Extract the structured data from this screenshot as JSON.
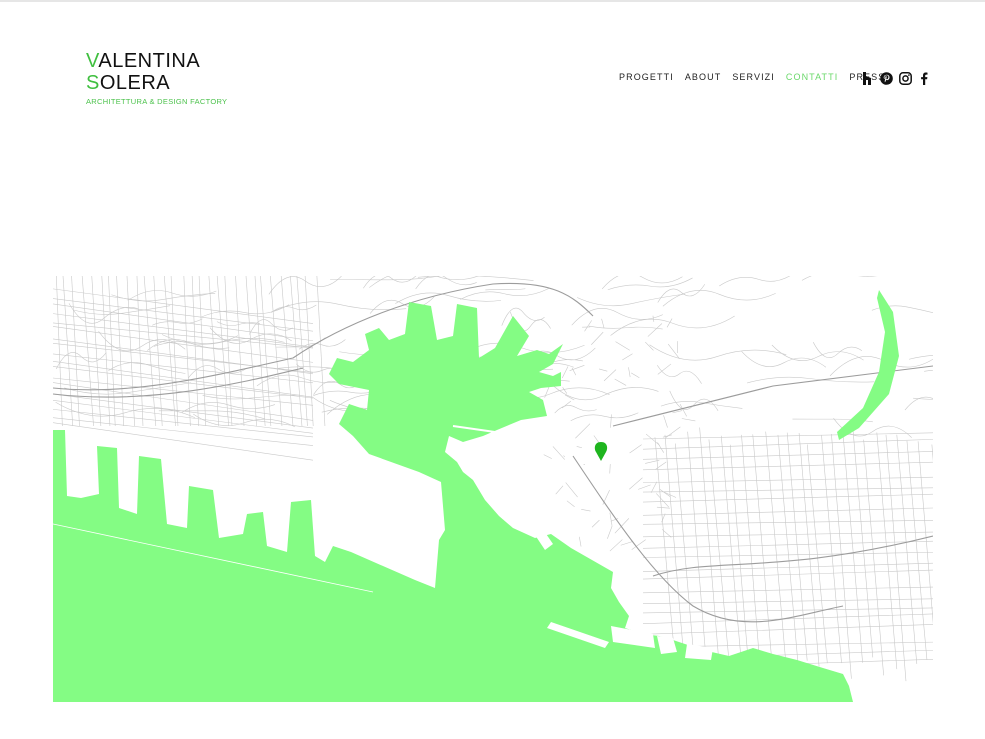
{
  "brand": {
    "line1_initial": "V",
    "line1_rest": "ALENTINA",
    "line2_initial": "S",
    "line2_rest": "OLERA",
    "tagline": "ARCHITETTURA & DESIGN FACTORY"
  },
  "nav": {
    "items": [
      {
        "label": "PROGETTI"
      },
      {
        "label": "ABOUT"
      },
      {
        "label": "SERVIZI"
      },
      {
        "label": "CONTATTI",
        "active": true
      },
      {
        "label": "PRESS"
      }
    ]
  },
  "social": [
    "houzz-icon",
    "pinterest-icon",
    "instagram-icon",
    "facebook-icon"
  ],
  "map": {
    "water_color": "#84fc84",
    "marker_color": "#1fb51f",
    "marker_icon": "map-pin-icon"
  }
}
